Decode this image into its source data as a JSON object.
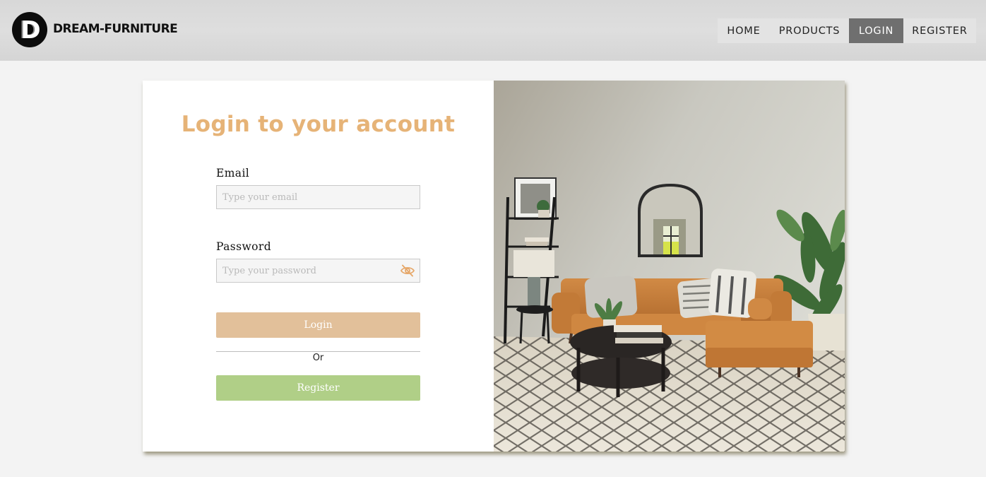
{
  "header": {
    "logo_letter": "D",
    "brand": "DREAM-FURNITURE",
    "nav": [
      {
        "label": "HOME"
      },
      {
        "label": "PRODUCTS"
      },
      {
        "label": "LOGIN"
      },
      {
        "label": "REGISTER"
      }
    ],
    "active_nav": "LOGIN"
  },
  "login_form": {
    "title": "Login to your account",
    "email": {
      "label": "Email",
      "placeholder": "Type your email",
      "value": ""
    },
    "password": {
      "label": "Password",
      "placeholder": "Type your password",
      "value": "",
      "toggle_icon": "eye-slash-icon"
    },
    "login_button": "Login",
    "separator": "Or",
    "register_button": "Register"
  },
  "hero_image": {
    "subject": "living-room-photo",
    "icon": "living-room-illustration"
  },
  "colors": {
    "title_accent": "#e6b377",
    "login_button": "#e2c09a",
    "register_button": "#b0cf87",
    "nav_active": "#6f6f6f"
  }
}
